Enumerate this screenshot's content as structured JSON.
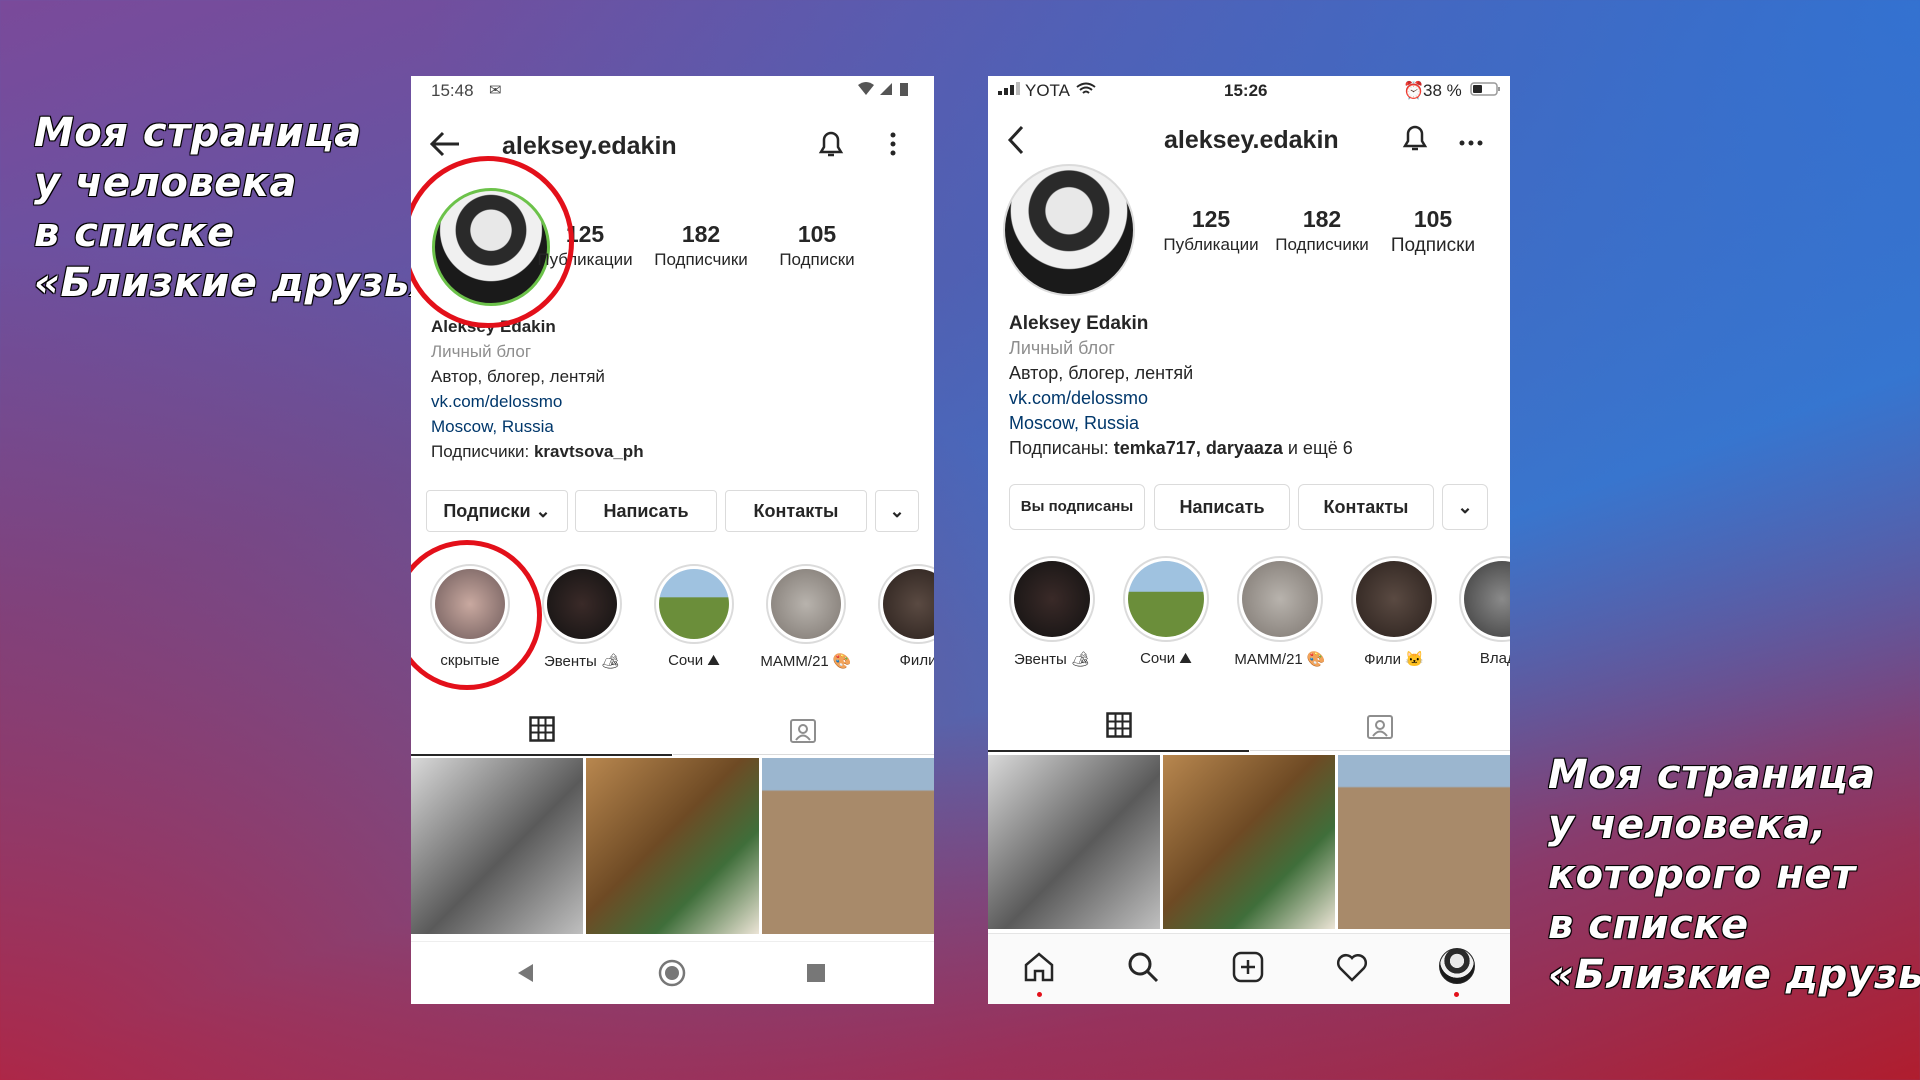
{
  "captions": {
    "left": [
      "Моя страница",
      "у человека",
      "в списке",
      "«Близкие друзья»"
    ],
    "right": [
      "Моя страница",
      "у человека,",
      "которого нет",
      "в списке",
      "«Близкие друзья»"
    ]
  },
  "phone_a": {
    "status_time": "15:48",
    "username": "aleksey.edakin",
    "stats": [
      {
        "num": "125",
        "label": "Публикации"
      },
      {
        "num": "182",
        "label": "Подписчики"
      },
      {
        "num": "105",
        "label": "Подписки"
      }
    ],
    "bio": {
      "name": "Aleksey Edakin",
      "category": "Личный блог",
      "description": "Автор, блогер, лентяй",
      "link1": "vk.com/delossmo",
      "location": "Moscow, Russia",
      "followed_by_prefix": "Подписчики: ",
      "followed_by": "kravtsova_ph"
    },
    "buttons": {
      "following": "Подписки",
      "message": "Написать",
      "contacts": "Контакты"
    },
    "stories": [
      "скрытые",
      "Эвенты 🏕",
      "Сочи ⛰",
      "МАММ/21 🎨",
      "Фили"
    ]
  },
  "phone_b": {
    "status_carrier": "YOTA",
    "status_time": "15:26",
    "status_battery": "38 %",
    "username": "aleksey.edakin",
    "stats": [
      {
        "num": "125",
        "label": "Публикации"
      },
      {
        "num": "182",
        "label": "Подписчики"
      },
      {
        "num": "105",
        "label": "Подписки"
      }
    ],
    "bio": {
      "name": "Aleksey Edakin",
      "category": "Личный блог",
      "description": "Автор, блогер, лентяй",
      "link1": "vk.com/delossmo",
      "location": "Moscow, Russia",
      "followed_by_prefix": "Подписаны: ",
      "followed_by": "temka717, daryaaza",
      "followed_by_suffix": " и ещё 6"
    },
    "buttons": {
      "following": "Вы подписаны",
      "message": "Написать",
      "contacts": "Контакты"
    },
    "stories": [
      "Эвенты 🏕",
      "Сочи ⛰",
      "МАММ/21 🎨",
      "Фили 🐱",
      "Влади"
    ]
  },
  "colors": {
    "highlight_circle": "#e3101a",
    "link": "#00376b"
  }
}
